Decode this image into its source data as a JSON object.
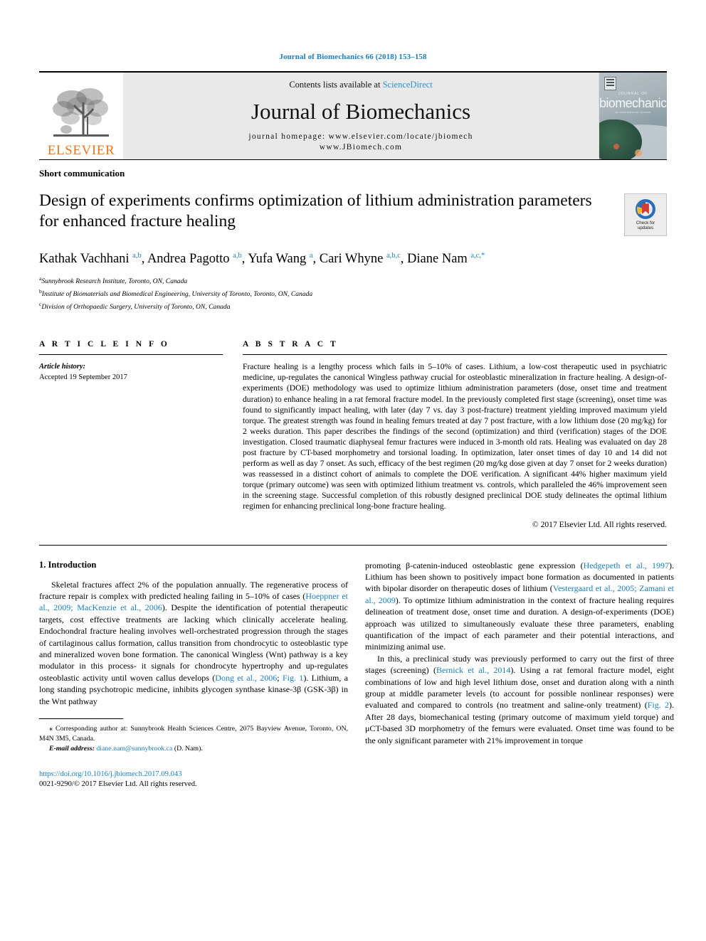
{
  "running_head": "Journal of Biomechanics 66 (2018) 153–158",
  "masthead": {
    "contents_prefix": "Contents lists available at ",
    "sciencedirect": "ScienceDirect",
    "journal_title": "Journal of Biomechanics",
    "homepage_line1": "journal homepage: www.elsevier.com/locate/jbiomech",
    "homepage_line2": "www.JBiomech.com",
    "publisher_name": "ELSEVIER",
    "cover": {
      "journal_word": "JOURNAL OF",
      "title_word": "biomechanics",
      "subtitle_word": "an international journal"
    },
    "accent_blue": "#2596d4",
    "elsevier_orange": "#E87722"
  },
  "article": {
    "type": "Short communication",
    "title": "Design of experiments confirms optimization of lithium administration parameters for enhanced fracture healing",
    "crossmark": {
      "line1": "Check for",
      "line2": "updates"
    },
    "authors_html": "Kathak Vachhani <sup>a,b</sup>, Andrea Pagotto <sup>a,b</sup>, Yufa Wang <sup>a</sup>, Cari Whyne <sup>a,b,c</sup>, Diane Nam <sup>a,c,</sup><sup>*</sup>",
    "affiliations": [
      {
        "marker": "a",
        "text": "Sunnybrook Research Institute, Toronto, ON, Canada"
      },
      {
        "marker": "b",
        "text": "Institute of Biomaterials and Biomedical Engineering, University of Toronto, Toronto, ON, Canada"
      },
      {
        "marker": "c",
        "text": "Division of Orthopaedic Surgery, University of Toronto, ON, Canada"
      }
    ]
  },
  "info": {
    "heading": "A R T I C L E   I N F O",
    "history_label": "Article history:",
    "history_value": "Accepted 19 September 2017"
  },
  "abstract": {
    "heading": "A B S T R A C T",
    "text": "Fracture healing is a lengthy process which fails in 5–10% of cases. Lithium, a low-cost therapeutic used in psychiatric medicine, up-regulates the canonical Wingless pathway crucial for osteoblastic mineralization in fracture healing. A design-of-experiments (DOE) methodology was used to optimize lithium administration parameters (dose, onset time and treatment duration) to enhance healing in a rat femoral fracture model. In the previously completed first stage (screening), onset time was found to significantly impact healing, with later (day 7 vs. day 3 post-fracture) treatment yielding improved maximum yield torque. The greatest strength was found in healing femurs treated at day 7 post fracture, with a low lithium dose (20 mg/kg) for 2 weeks duration. This paper describes the findings of the second (optimization) and third (verification) stages of the DOE investigation. Closed traumatic diaphyseal femur fractures were induced in 3-month old rats. Healing was evaluated on day 28 post fracture by CT-based morphometry and torsional loading. In optimization, later onset times of day 10 and 14 did not perform as well as day 7 onset. As such, efficacy of the best regimen (20 mg/kg dose given at day 7 onset for 2 weeks duration) was reassessed in a distinct cohort of animals to complete the DOE verification. A significant 44% higher maximum yield torque (primary outcome) was seen with optimized lithium treatment vs. controls, which paralleled the 46% improvement seen in the screening stage. Successful completion of this robustly designed preclinical DOE study delineates the optimal lithium regimen for enhancing preclinical long-bone fracture healing.",
    "copyright": "© 2017 Elsevier Ltd. All rights reserved."
  },
  "introduction": {
    "heading": "1. Introduction",
    "left_para1_html": "Skeletal fractures affect 2% of the population annually. The regenerative process of fracture repair is complex with predicted healing failing in 5–10% of cases (<span class=\"cite\">Hoeppner et al., 2009; MacKenzie et al., 2006</span>). Despite the identification of potential therapeutic targets, cost effective treatments are lacking which clinically accelerate healing. Endochondral fracture healing involves well-orchestrated progression through the stages of cartilaginous callus formation, callus transition from chondrocytic to osteoblastic type and mineralized woven bone formation. The canonical Wingless (Wnt) pathway is a key modulator in this process- it signals for chondrocyte hypertrophy and up-regulates osteoblastic activity until woven callus develops (<span class=\"cite\">Dong et al., 2006</span>; <span class=\"cite\">Fig. 1</span>). Lithium, a long standing psychotropic medicine, inhibits glycogen synthase kinase-3β (GSK-3β) in the Wnt pathway",
    "right_para1_html": "promoting β-catenin-induced osteoblastic gene expression (<span class=\"cite\">Hedgepeth et al., 1997</span>). Lithium has been shown to positively impact bone formation as documented in patients with bipolar disorder on therapeutic doses of lithium (<span class=\"cite\">Vestergaard et al., 2005; Zamani et al., 2009</span>). To optimize lithium administration in the context of fracture healing requires delineation of treatment dose, onset time and duration. A design-of-experiments (DOE) approach was utilized to simultaneously evaluate these three parameters, enabling quantification of the impact of each parameter and their potential interactions, and minimizing animal use.",
    "right_para2_html": "In this, a preclinical study was previously performed to carry out the first of three stages (screening) (<span class=\"cite\">Bernick et al., 2014</span>). Using a rat femoral fracture model, eight combinations of low and high level lithium dose, onset and duration along with a ninth group at middle parameter levels (to account for possible nonlinear responses) were evaluated and compared to controls (no treatment and saline-only treatment) (<span class=\"cite\">Fig. 2</span>). After 28 days, biomechanical testing (primary outcome of maximum yield torque) and μCT-based 3D morphometry of the femurs were evaluated. Onset time was found to be the only significant parameter with 21% improvement in torque"
  },
  "footnotes": {
    "corresponding_html": "⁎ Corresponding author at: Sunnybrook Health Sciences Centre, 2075 Bayview Avenue, Toronto, ON, M4N 3M5, Canada.",
    "email_label": "E-mail address:",
    "email_value": "diane.nam@sunnybrook.ca",
    "email_suffix": " (D. Nam).",
    "doi": "https://doi.org/10.1016/j.jbiomech.2017.09.043",
    "issn_line": "0021-9290/© 2017 Elsevier Ltd. All rights reserved."
  }
}
